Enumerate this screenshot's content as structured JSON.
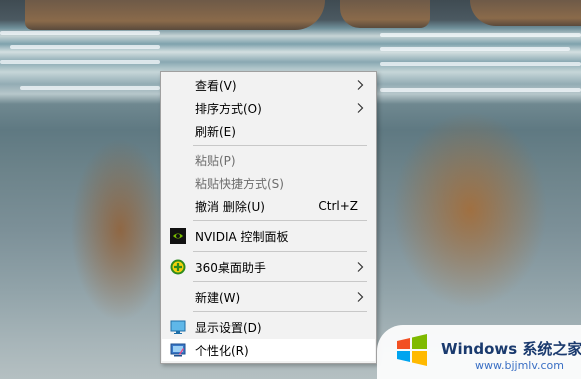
{
  "context_menu": {
    "items": [
      {
        "label": "查看(V)"
      },
      {
        "label": "排序方式(O)"
      },
      {
        "label": "刷新(E)"
      },
      {
        "label": "粘贴(P)",
        "disabled": true
      },
      {
        "label": "粘贴快捷方式(S)",
        "disabled": true
      },
      {
        "label": "撤消 删除(U)",
        "shortcut": "Ctrl+Z"
      },
      {
        "label": "NVIDIA 控制面板",
        "icon": "nvidia-icon"
      },
      {
        "label": "360桌面助手",
        "icon": "360-icon"
      },
      {
        "label": "新建(W)"
      },
      {
        "label": "显示设置(D)",
        "icon": "display-icon"
      },
      {
        "label": "个性化(R)",
        "icon": "personalize-icon",
        "highlighted": true
      }
    ]
  },
  "watermark": {
    "title": "Windows 系统之家",
    "url": "www.bjjmlv.com"
  },
  "colors": {
    "menu_background": "#f2f2f2",
    "menu_highlight": "#ffffff",
    "disabled_text": "#6d6d6d",
    "watermark_title": "#1a3a6e",
    "watermark_url": "#3a6fc4"
  }
}
